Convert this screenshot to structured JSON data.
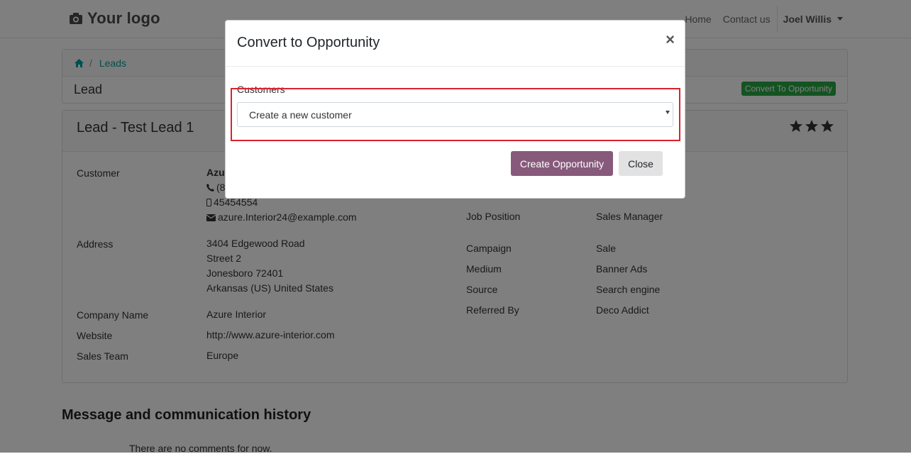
{
  "navbar": {
    "logo_text": "Your logo",
    "links": [
      "Home",
      "Contact us"
    ],
    "user_name": "Joel Willis"
  },
  "breadcrumb": {
    "home_icon": "home-icon",
    "current": "Leads"
  },
  "lead_header": {
    "title": "Lead",
    "convert_button": "Convert To Opportunity"
  },
  "lead": {
    "title": "Lead - Test Lead 1",
    "priority_stars": 3,
    "left_fields": {
      "customer_label": "Customer",
      "customer_name": "Azu",
      "phone_partial": "(8",
      "mobile": "45454554",
      "email": "azure.Interior24@example.com",
      "address_label": "Address",
      "address_lines": [
        "3404 Edgewood Road",
        "Street 2",
        "Jonesboro 72401",
        "Arkansas (US) United States"
      ],
      "company_label": "Company Name",
      "company_value": "Azure Interior",
      "website_label": "Website",
      "website_value": "http://www.azure-interior.com",
      "team_label": "Sales Team",
      "team_value": "Europe"
    },
    "right_fields": [
      {
        "label": "Job Position",
        "value": "Sales Manager"
      },
      {
        "label": "Campaign",
        "value": "Sale"
      },
      {
        "label": "Medium",
        "value": "Banner Ads"
      },
      {
        "label": "Source",
        "value": "Search engine"
      },
      {
        "label": "Referred By",
        "value": "Deco Addict"
      }
    ]
  },
  "history": {
    "title": "Message and communication history",
    "empty_text": "There are no comments for now."
  },
  "modal": {
    "title": "Convert to Opportunity",
    "close_symbol": "×",
    "field_label": "Customers",
    "select_value": "Create a new customer",
    "primary_button": "Create Opportunity",
    "secondary_button": "Close"
  },
  "colors": {
    "accent": "#00a09d",
    "primary_button": "#875a7b",
    "success_button": "#28a745",
    "highlight_border": "#d9232d"
  }
}
